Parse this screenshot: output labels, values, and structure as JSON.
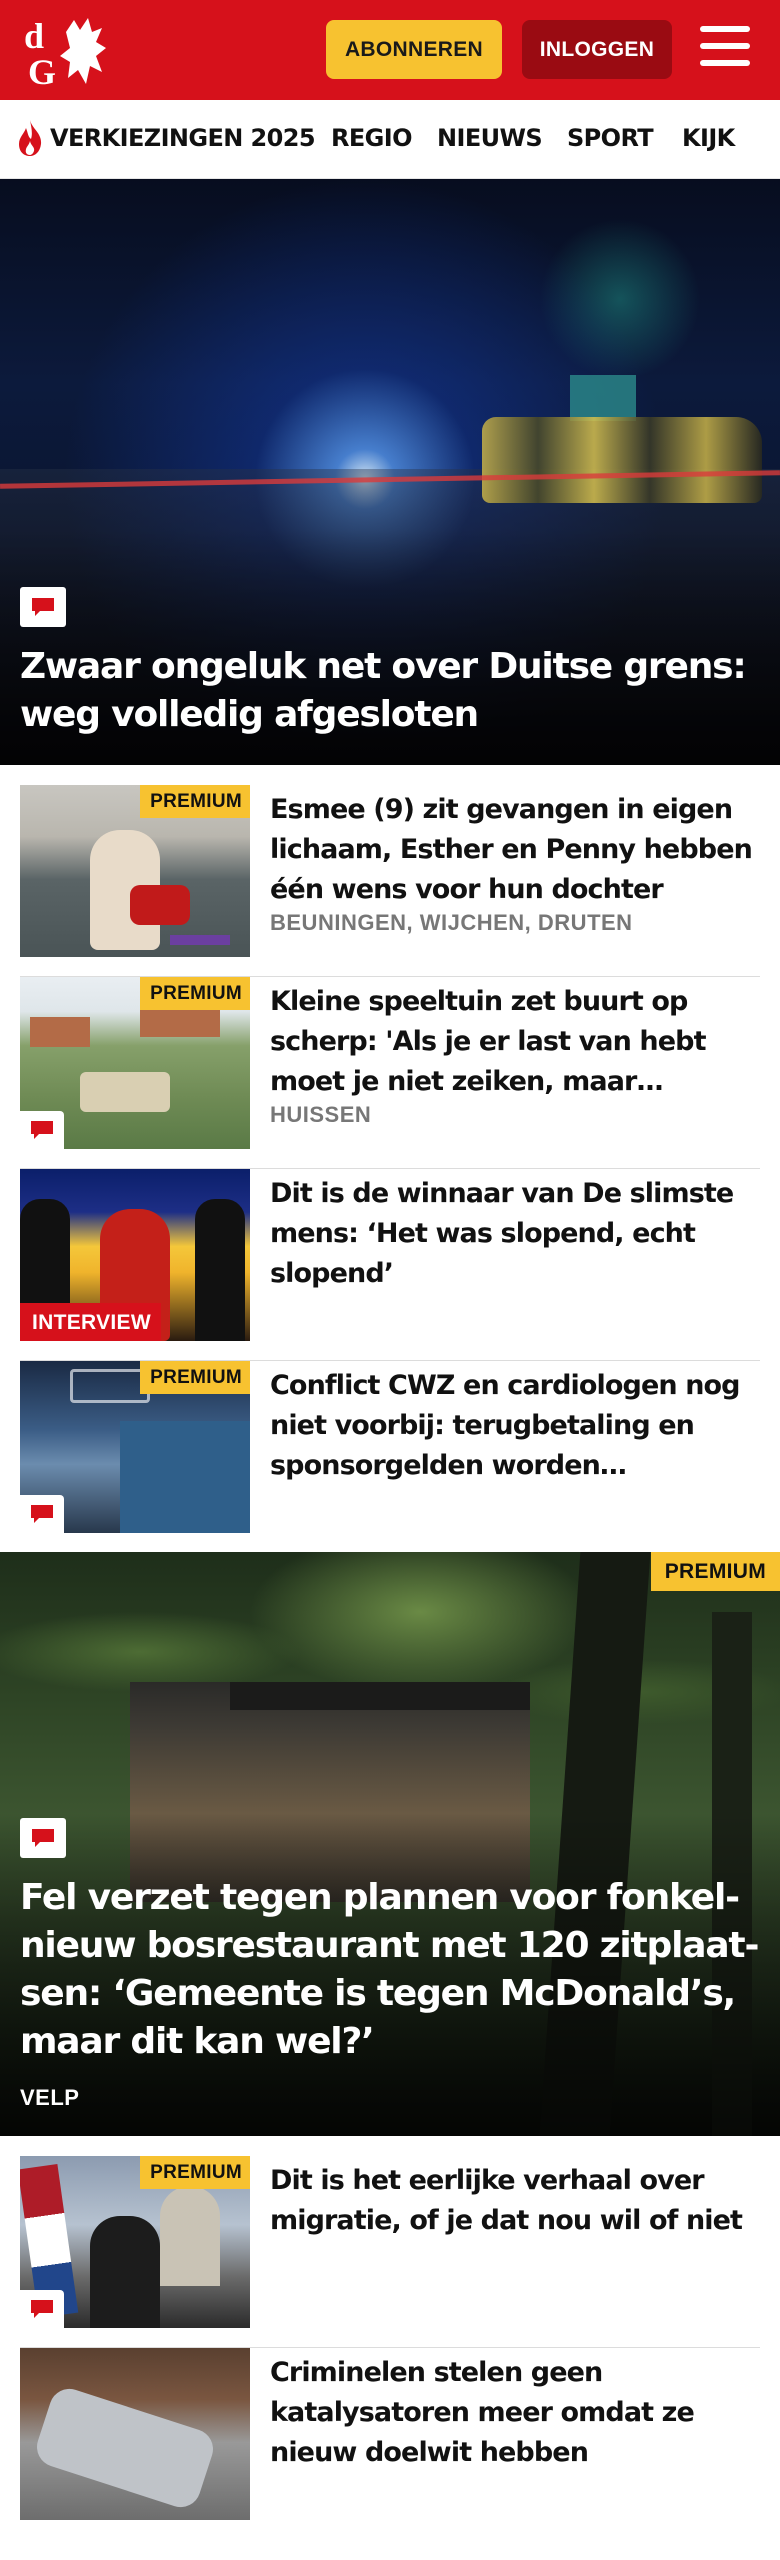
{
  "header": {
    "logo_text": "dG",
    "subscribe_label": "ABONNEREN",
    "login_label": "INLOGGEN",
    "colors": {
      "brand_red": "#d6111b",
      "subscribe_yellow": "#f7c230",
      "login_dark_red": "#9a0b12"
    }
  },
  "nav": {
    "items": [
      {
        "label": "VERKIEZINGEN 2025",
        "icon": "flame-icon"
      },
      {
        "label": "REGIO"
      },
      {
        "label": "NIEUWS"
      },
      {
        "label": "SPORT"
      },
      {
        "label": "KIJK"
      }
    ]
  },
  "hero": {
    "title": "Zwaar ongeluk net over Duitse grens: weg volledig afgesloten",
    "icon": "comment-icon"
  },
  "articles": [
    {
      "title": "Esmee (9) zit gevangen in eigen lichaam, Esther en Penny hebben één wens voor hun dochter",
      "meta": "BEUNINGEN, WIJCHEN, DRUTEN",
      "badge": "PREMIUM"
    },
    {
      "title": "Kleine speeltuin zet buurt op scherp: 'Als je er last van hebt moet je niet zeiken, maar…",
      "meta": "HUISSEN",
      "badge": "PREMIUM",
      "icon": "comment-icon"
    },
    {
      "title": "Dit is de winnaar van De slimste mens: ‘Het was slopend, echt slopend’",
      "badge": "INTERVIEW"
    },
    {
      "title": "Conflict CWZ en cardiologen nog niet voorbij: terugbetaling en sponsorgelden worden…",
      "badge": "PREMIUM",
      "icon": "comment-icon"
    }
  ],
  "feature": {
    "badge": "PREMIUM",
    "title": "Fel verzet tegen plannen voor fonkel­nieuw bosrestaurant met 120 zitplaat­sen: ‘Gemeente is tegen McDonald’s, maar dit kan wel?’",
    "meta": "VELP",
    "icon": "comment-icon"
  },
  "articles2": [
    {
      "title": "Dit is het eerlijke verhaal over migratie, of je dat nou wil of niet",
      "badge": "PREMIUM",
      "icon": "comment-icon"
    },
    {
      "title": "Criminelen stelen geen katalysatoren meer omdat ze nieuw doelwit hebben"
    }
  ]
}
